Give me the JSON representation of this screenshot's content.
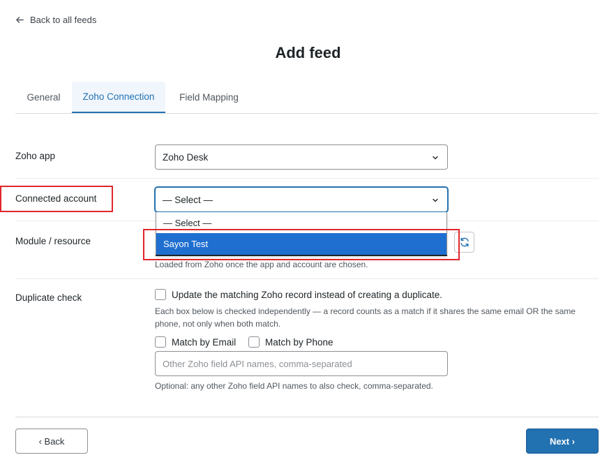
{
  "nav": {
    "back_label": "Back to all feeds"
  },
  "page": {
    "title": "Add feed"
  },
  "tabs": [
    {
      "label": "General"
    },
    {
      "label": "Zoho Connection"
    },
    {
      "label": "Field Mapping"
    }
  ],
  "form": {
    "zoho_app": {
      "label": "Zoho app",
      "value": "Zoho Desk"
    },
    "connected_account": {
      "label": "Connected account",
      "value": "— Select —",
      "options": [
        "— Select —",
        "Sayon Test"
      ],
      "highlighted": "Sayon Test"
    },
    "module": {
      "label": "Module / resource",
      "help": "Loaded from Zoho once the app and account are chosen."
    },
    "duplicate": {
      "label": "Duplicate check",
      "update_label": "Update the matching Zoho record instead of creating a duplicate.",
      "help": "Each box below is checked independently — a record counts as a match if it shares the same email OR the same phone, not only when both match.",
      "email_label": "Match by Email",
      "phone_label": "Match by Phone",
      "other_placeholder": "Other Zoho field API names, comma-separated",
      "other_help": "Optional: any other Zoho field API names to also check, comma-separated."
    }
  },
  "footer": {
    "back_label": "‹ Back",
    "next_label": "Next ›"
  },
  "colors": {
    "accent": "#2271b1",
    "highlight": "#1f6fd1",
    "annotation": "#e0262b"
  }
}
